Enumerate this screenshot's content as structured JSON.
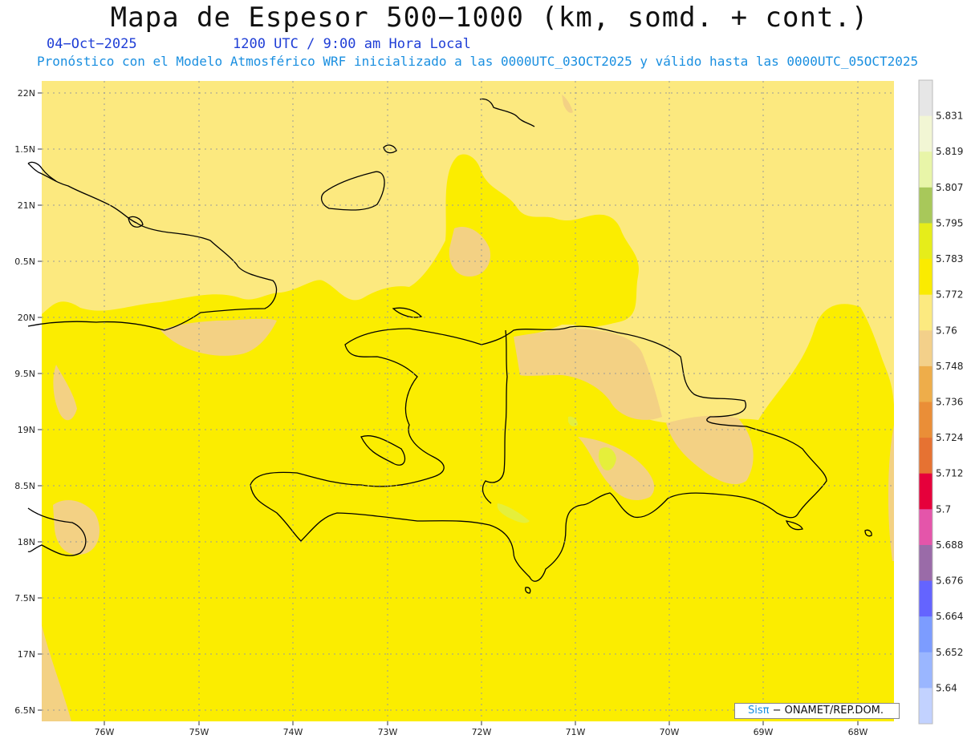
{
  "header": {
    "title": "Mapa de Espesor 500−1000 (km, somd. + cont.)",
    "date": "04−Oct−2025",
    "time": "1200 UTC / 9:00 am Hora Local",
    "description": "Pronóstico con el Modelo Atmosférico WRF inicializado a las 0000UTC_03OCT2025 y válido hasta las  0000UTC_05OCT2025"
  },
  "map": {
    "lon_labels": [
      "76W",
      "75W",
      "74W",
      "73W",
      "72W",
      "71W",
      "70W",
      "69W",
      "68W"
    ],
    "lat_labels": [
      "22N",
      "1.5N",
      "21N",
      "0.5N",
      "20N",
      "9.5N",
      "19N",
      "8.5N",
      "18N",
      "7.5N",
      "17N",
      "6.5N"
    ],
    "colors": {
      "ocean_fill": "#fce97f",
      "main_fill": "#fbed00",
      "tan_fill": "#f3d184",
      "green_fill": "#e5ef3b",
      "coastline": "#000000"
    }
  },
  "legend": {
    "labels": [
      "5.831",
      "5.819",
      "5.807",
      "5.795",
      "5.783",
      "5.772",
      "5.76",
      "5.748",
      "5.736",
      "5.724",
      "5.712",
      "5.7",
      "5.688",
      "5.676",
      "5.664",
      "5.652",
      "5.64"
    ],
    "colors": [
      "#e6e6e6",
      "#f2f6d4",
      "#e8f5a8",
      "#a8c85a",
      "#e6ed1a",
      "#faeb00",
      "#fcea80",
      "#f3d08a",
      "#eead4a",
      "#ea8e37",
      "#e67232",
      "#e6003b",
      "#e455aa",
      "#9a6ba8",
      "#6464ff",
      "#7c9cff",
      "#9ab6ff",
      "#c2d2ff"
    ]
  },
  "credit": {
    "brand": "Sisπ",
    "text": "− ONAMET/REP.DOM."
  }
}
